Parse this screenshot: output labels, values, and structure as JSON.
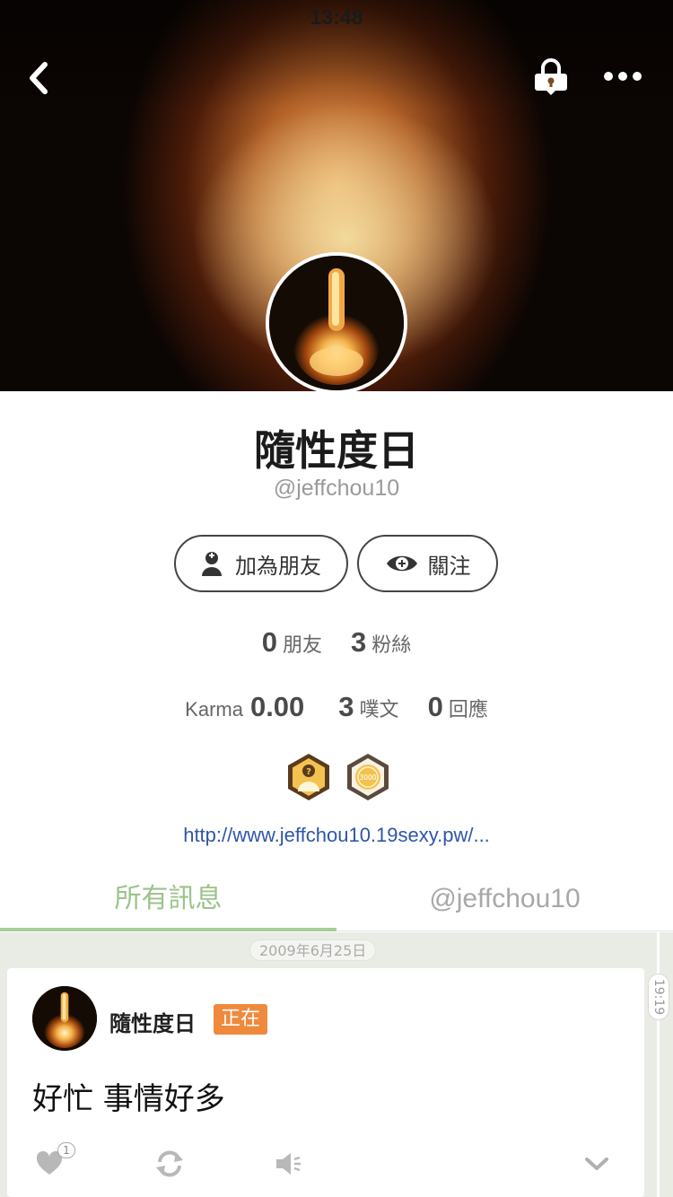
{
  "status_bar": {
    "time": "13:48"
  },
  "header": {
    "back_icon": "chevron-left-icon",
    "lock_icon": "lock-bubble-icon",
    "more_icon": "ellipsis-icon"
  },
  "profile": {
    "display_name": "隨性度日",
    "handle": "@jeffchou10",
    "add_friend_label": "加為朋友",
    "follow_label": "關注",
    "stats": {
      "friends_count": "0",
      "friends_label": "朋友",
      "fans_count": "3",
      "fans_label": "粉絲",
      "karma_label": "Karma",
      "karma_value": "0.00",
      "plurks_count": "3",
      "plurks_label": "噗文",
      "responses_count": "0",
      "responses_label": "回應"
    },
    "badges": [
      {
        "icon": "mystery-user-badge-icon"
      },
      {
        "icon": "3000-coin-badge-icon",
        "text": "3000"
      }
    ],
    "link": "http://www.jeffchou10.19sexy.pw/..."
  },
  "tabs": [
    {
      "label": "所有訊息",
      "active": true
    },
    {
      "label": "@jeffchou10",
      "active": false
    }
  ],
  "timeline": {
    "date": "2009年6月25日",
    "time": "19:19",
    "plurk": {
      "author": "隨性度日",
      "qualifier": "正在",
      "text": "好忙 事情好多",
      "like_count": "1",
      "actions": [
        "heart-icon",
        "replurk-icon",
        "mute-icon",
        "chevron-down-icon"
      ]
    }
  },
  "colors": {
    "accent_green": "#9bc38a",
    "qualifier_orange": "#ef8a3c",
    "link_blue": "#2f56a8"
  }
}
